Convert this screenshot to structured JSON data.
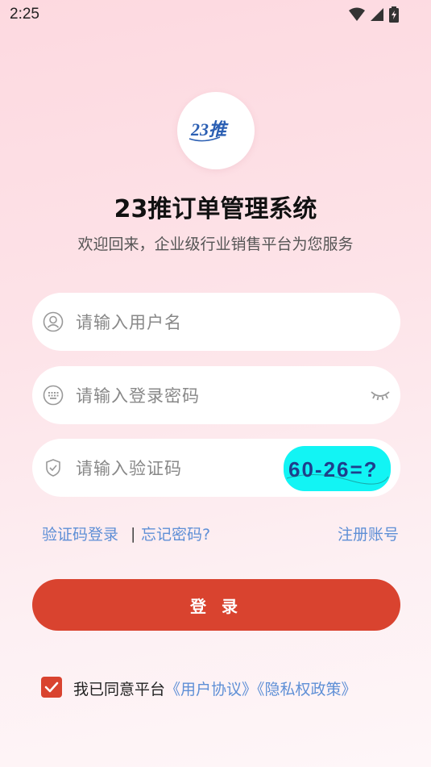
{
  "status_bar": {
    "time": "2:25"
  },
  "logo": {
    "text": "23推",
    "color": "#2b5fb3"
  },
  "header": {
    "title": "23推订单管理系统",
    "subtitle": "欢迎回来，企业级行业销售平台为您服务"
  },
  "form": {
    "username_placeholder": "请输入用户名",
    "password_placeholder": "请输入登录密码",
    "captcha_placeholder": "请输入验证码",
    "captcha_text": "60-26=?"
  },
  "links": {
    "sms_login": "验证码登录",
    "separator": "|",
    "forgot_password": "忘记密码?",
    "register": "注册账号"
  },
  "login_button": {
    "label": "登 录"
  },
  "agreement": {
    "prefix": "我已同意平台",
    "user_agreement": "《用户协议》",
    "privacy_policy": "《隐私权政策》",
    "checked": true
  },
  "colors": {
    "accent": "#d9432f",
    "link": "#5e8fd6"
  }
}
